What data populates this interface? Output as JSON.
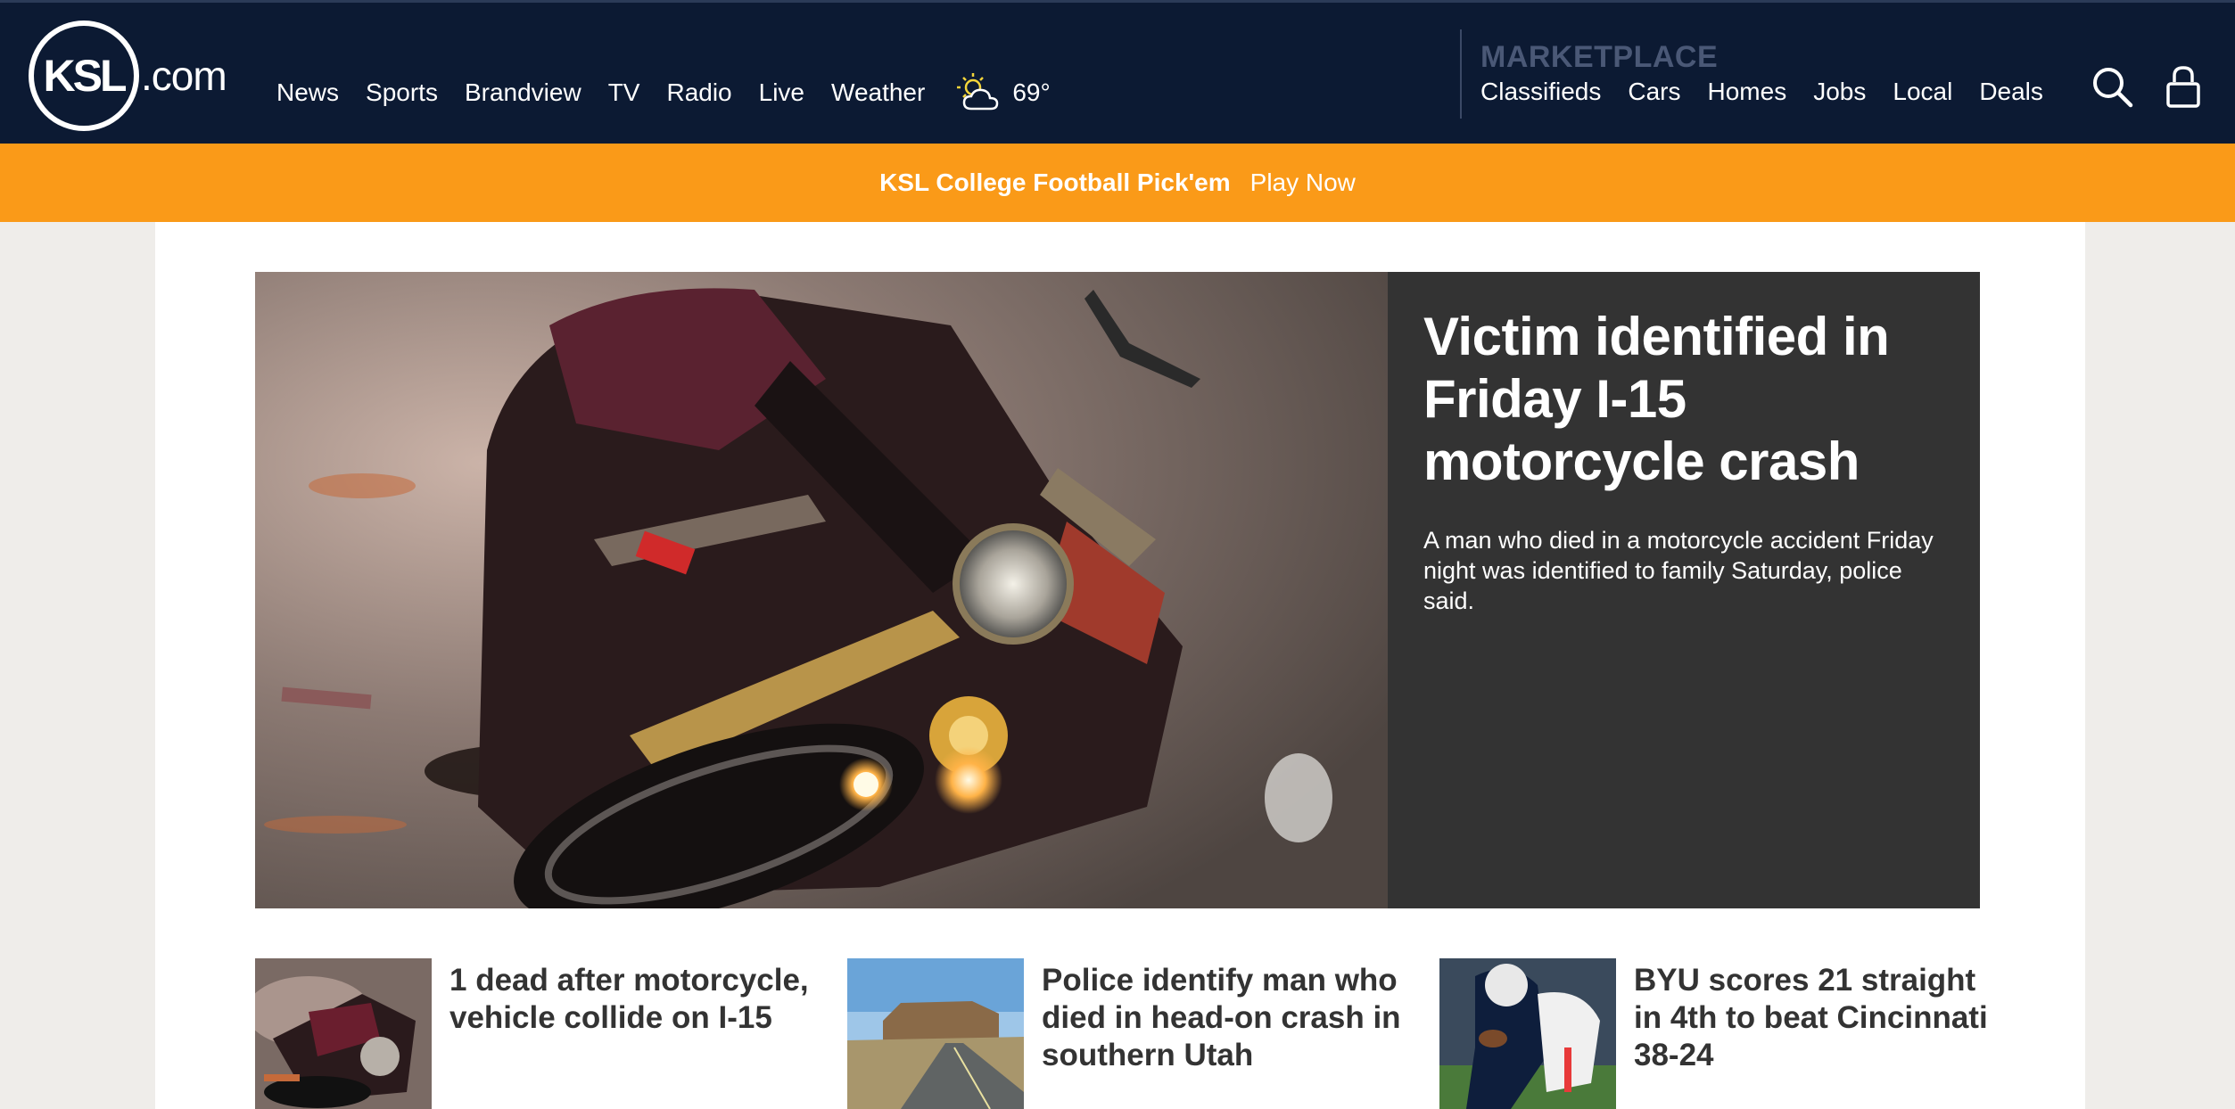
{
  "header": {
    "logo_main": "KSL",
    "logo_suffix": ".com",
    "nav": [
      "News",
      "Sports",
      "Brandview",
      "TV",
      "Radio",
      "Live",
      "Weather"
    ],
    "weather": {
      "icon": "partly-cloudy-icon",
      "temp": "69°"
    },
    "marketplace": {
      "title": "MARKETPLACE",
      "links": [
        "Classifieds",
        "Cars",
        "Homes",
        "Jobs",
        "Local",
        "Deals"
      ]
    },
    "icons": [
      "search-icon",
      "user-icon"
    ]
  },
  "promo": {
    "title": "KSL College Football Pick'em",
    "link": "Play Now"
  },
  "hero": {
    "headline": "Victim identified in Friday I-15 motorcycle crash",
    "summary": "A man who died in a motorcycle accident Friday night was identified to family Saturday, police said."
  },
  "stories": [
    {
      "title": "1 dead after motorcycle, vehicle collide on I-15"
    },
    {
      "title": "Police identify man who died in head-on crash in southern Utah"
    },
    {
      "title": "BYU scores 21 straight in 4th to beat Cincinnati 38-24"
    }
  ],
  "colors": {
    "nav_bg": "#0c1a33",
    "promo_bg": "#fa9a18",
    "hero_text_bg": "#333333"
  }
}
